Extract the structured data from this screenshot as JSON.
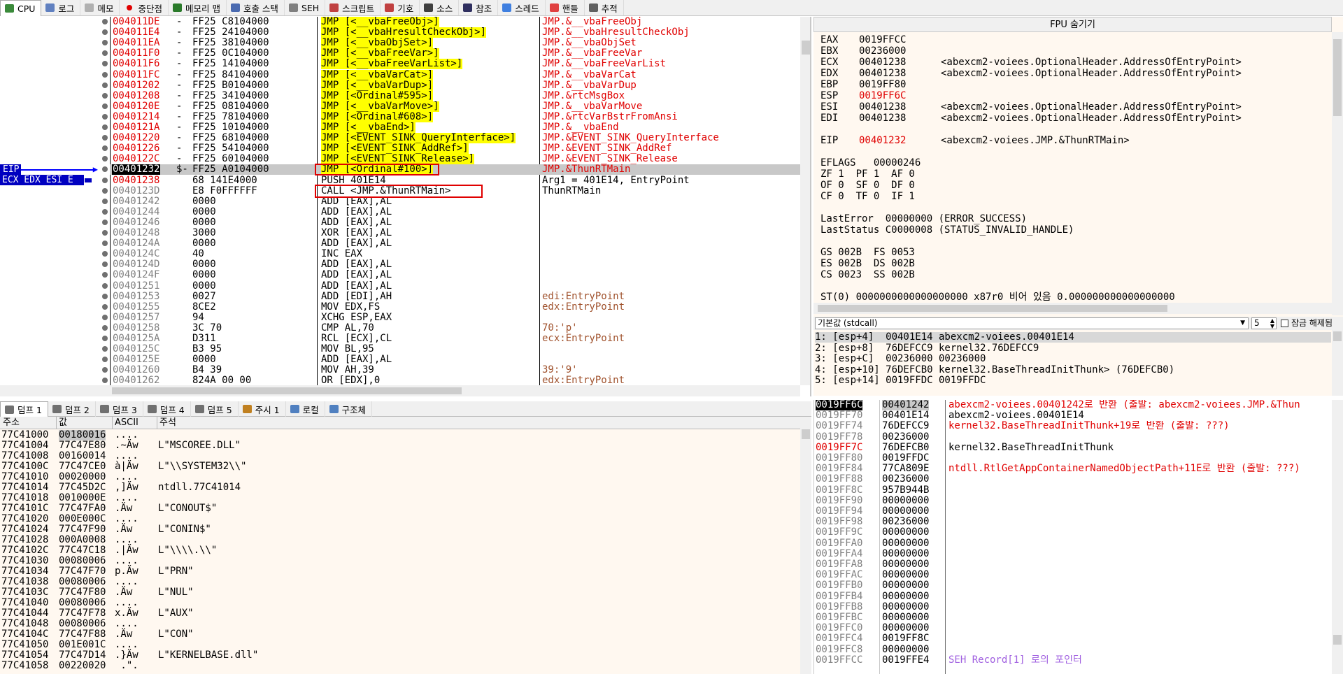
{
  "tabs": [
    {
      "label": "CPU",
      "icon": "cpu-icon",
      "active": true
    },
    {
      "label": "로그",
      "icon": "log-icon"
    },
    {
      "label": "메모",
      "icon": "note-icon"
    },
    {
      "label": "중단점",
      "icon": "breakpoint-icon"
    },
    {
      "label": "메모리 맵",
      "icon": "memory-map-icon"
    },
    {
      "label": "호출 스택",
      "icon": "call-stack-icon"
    },
    {
      "label": "SEH",
      "icon": "seh-icon"
    },
    {
      "label": "스크립트",
      "icon": "script-icon"
    },
    {
      "label": "기호",
      "icon": "symbol-icon"
    },
    {
      "label": "소스",
      "icon": "source-icon"
    },
    {
      "label": "참조",
      "icon": "reference-icon"
    },
    {
      "label": "스레드",
      "icon": "thread-icon"
    },
    {
      "label": "핸들",
      "icon": "handle-icon"
    },
    {
      "label": "추적",
      "icon": "trace-icon"
    }
  ],
  "disasm": {
    "eip_label": "EIP",
    "reg_label": "ECX EDX ESI E",
    "rows": [
      {
        "addr": "004011DE",
        "marker": "-",
        "bytes": "FF25 C8104000",
        "instr": "JMP [<__vbaFreeObj>]",
        "comment": "JMP.&__vbaFreeObj",
        "type": "jmp"
      },
      {
        "addr": "004011E4",
        "marker": "-",
        "bytes": "FF25 24104000",
        "instr": "JMP [<__vbaHresultCheckObj>]",
        "comment": "JMP.&__vbaHresultCheckObj",
        "type": "jmp"
      },
      {
        "addr": "004011EA",
        "marker": "-",
        "bytes": "FF25 38104000",
        "instr": "JMP [<__vbaObjSet>]",
        "comment": "JMP.&__vbaObjSet",
        "type": "jmp"
      },
      {
        "addr": "004011F0",
        "marker": "-",
        "bytes": "FF25 0C104000",
        "instr": "JMP [<__vbaFreeVar>]",
        "comment": "JMP.&__vbaFreeVar",
        "type": "jmp"
      },
      {
        "addr": "004011F6",
        "marker": "-",
        "bytes": "FF25 14104000",
        "instr": "JMP [<__vbaFreeVarList>]",
        "comment": "JMP.&__vbaFreeVarList",
        "type": "jmp"
      },
      {
        "addr": "004011FC",
        "marker": "-",
        "bytes": "FF25 84104000",
        "instr": "JMP [<__vbaVarCat>]",
        "comment": "JMP.&__vbaVarCat",
        "type": "jmp"
      },
      {
        "addr": "00401202",
        "marker": "-",
        "bytes": "FF25 B0104000",
        "instr": "JMP [<__vbaVarDup>]",
        "comment": "JMP.&__vbaVarDup",
        "type": "jmp"
      },
      {
        "addr": "00401208",
        "marker": "-",
        "bytes": "FF25 34104000",
        "instr": "JMP [<Ordinal#595>]",
        "comment": "JMP.&rtcMsgBox",
        "type": "jmp"
      },
      {
        "addr": "0040120E",
        "marker": "-",
        "bytes": "FF25 08104000",
        "instr": "JMP [<__vbaVarMove>]",
        "comment": "JMP.&__vbaVarMove",
        "type": "jmp"
      },
      {
        "addr": "00401214",
        "marker": "-",
        "bytes": "FF25 78104000",
        "instr": "JMP [<Ordinal#608>]",
        "comment": "JMP.&rtcVarBstrFromAnsi",
        "type": "jmp"
      },
      {
        "addr": "0040121A",
        "marker": "-",
        "bytes": "FF25 10104000",
        "instr": "JMP [<__vbaEnd>]",
        "comment": "JMP.&__vbaEnd",
        "type": "jmp"
      },
      {
        "addr": "00401220",
        "marker": "-",
        "bytes": "FF25 68104000",
        "instr": "JMP [<EVENT_SINK_QueryInterface>]",
        "comment": "JMP.&EVENT_SINK_QueryInterface",
        "type": "jmp"
      },
      {
        "addr": "00401226",
        "marker": "-",
        "bytes": "FF25 54104000",
        "instr": "JMP [<EVENT_SINK_AddRef>]",
        "comment": "JMP.&EVENT_SINK_AddRef",
        "type": "jmp"
      },
      {
        "addr": "0040122C",
        "marker": "-",
        "bytes": "FF25 60104000",
        "instr": "JMP [<EVENT_SINK_Release>]",
        "comment": "JMP.&EVENT_SINK_Release",
        "type": "jmp"
      },
      {
        "addr": "00401232",
        "marker": "$-",
        "bytes": "FF25 A0104000",
        "instr": "JMP [<Ordinal#100>]",
        "comment": "JMP.&ThunRTMain",
        "type": "eip"
      },
      {
        "addr": "00401238",
        "marker": "",
        "bytes": "68 141E4000",
        "instr": "PUSH 401E14",
        "comment": "Arg1 = 401E14, EntryPoint",
        "type": "push"
      },
      {
        "addr": "0040123D",
        "marker": "",
        "bytes": "E8 F0FFFFFF",
        "instr": "CALL <JMP.&ThunRTMain>",
        "comment": "ThunRTMain",
        "type": "call"
      },
      {
        "addr": "00401242",
        "marker": "",
        "bytes": "0000",
        "instr": "ADD [EAX],AL",
        "comment": "",
        "type": "norm"
      },
      {
        "addr": "00401244",
        "marker": "",
        "bytes": "0000",
        "instr": "ADD [EAX],AL",
        "comment": "",
        "type": "norm"
      },
      {
        "addr": "00401246",
        "marker": "",
        "bytes": "0000",
        "instr": "ADD [EAX],AL",
        "comment": "",
        "type": "norm"
      },
      {
        "addr": "00401248",
        "marker": "",
        "bytes": "3000",
        "instr": "XOR [EAX],AL",
        "comment": "",
        "type": "norm"
      },
      {
        "addr": "0040124A",
        "marker": "",
        "bytes": "0000",
        "instr": "ADD [EAX],AL",
        "comment": "",
        "type": "norm"
      },
      {
        "addr": "0040124C",
        "marker": "",
        "bytes": "40",
        "instr": "INC EAX",
        "comment": "",
        "type": "norm"
      },
      {
        "addr": "0040124D",
        "marker": "",
        "bytes": "0000",
        "instr": "ADD [EAX],AL",
        "comment": "",
        "type": "norm"
      },
      {
        "addr": "0040124F",
        "marker": "",
        "bytes": "0000",
        "instr": "ADD [EAX],AL",
        "comment": "",
        "type": "norm"
      },
      {
        "addr": "00401251",
        "marker": "",
        "bytes": "0000",
        "instr": "ADD [EAX],AL",
        "comment": "",
        "type": "norm"
      },
      {
        "addr": "00401253",
        "marker": "",
        "bytes": "0027",
        "instr": "ADD [EDI],AH",
        "comment": "edi:EntryPoint",
        "type": "norm"
      },
      {
        "addr": "00401255",
        "marker": "",
        "bytes": "8CE2",
        "instr": "MOV EDX,FS",
        "comment": "edx:EntryPoint",
        "type": "norm"
      },
      {
        "addr": "00401257",
        "marker": "",
        "bytes": "94",
        "instr": "XCHG ESP,EAX",
        "comment": "",
        "type": "norm"
      },
      {
        "addr": "00401258",
        "marker": "",
        "bytes": "3C 70",
        "instr": "CMP AL,70",
        "comment": "70:'p'",
        "type": "norm"
      },
      {
        "addr": "0040125A",
        "marker": "",
        "bytes": "D311",
        "instr": "RCL [ECX],CL",
        "comment": "ecx:EntryPoint",
        "type": "norm"
      },
      {
        "addr": "0040125C",
        "marker": "",
        "bytes": "B3 95",
        "instr": "MOV BL,95",
        "comment": "",
        "type": "norm"
      },
      {
        "addr": "0040125E",
        "marker": "",
        "bytes": "0000",
        "instr": "ADD [EAX],AL",
        "comment": "",
        "type": "norm"
      },
      {
        "addr": "00401260",
        "marker": "",
        "bytes": "B4 39",
        "instr": "MOV AH,39",
        "comment": "39:'9'",
        "type": "norm"
      },
      {
        "addr": "00401262",
        "marker": "",
        "bytes": "824A 00 00",
        "instr": "OR [EDX],0",
        "comment": "edx:EntryPoint",
        "type": "norm"
      }
    ]
  },
  "registers": {
    "title": "FPU 숨기기",
    "lines": [
      {
        "name": "EAX",
        "value": "0019FFCC",
        "comment": "",
        "red": false
      },
      {
        "name": "EBX",
        "value": "00236000",
        "comment": "",
        "red": false
      },
      {
        "name": "ECX",
        "value": "00401238",
        "comment": "<abexcm2-voiees.OptionalHeader.AddressOfEntryPoint>",
        "red": false
      },
      {
        "name": "EDX",
        "value": "00401238",
        "comment": "<abexcm2-voiees.OptionalHeader.AddressOfEntryPoint>",
        "red": false
      },
      {
        "name": "EBP",
        "value": "0019FF80",
        "comment": "",
        "red": false
      },
      {
        "name": "ESP",
        "value": "0019FF6C",
        "comment": "",
        "red": true
      },
      {
        "name": "ESI",
        "value": "00401238",
        "comment": "<abexcm2-voiees.OptionalHeader.AddressOfEntryPoint>",
        "red": false
      },
      {
        "name": "EDI",
        "value": "00401238",
        "comment": "<abexcm2-voiees.OptionalHeader.AddressOfEntryPoint>",
        "red": false
      }
    ],
    "eip": {
      "name": "EIP",
      "value": "00401232",
      "comment": "<abexcm2-voiees.JMP.&ThunRTMain>"
    },
    "eflags": "EFLAGS   00000246",
    "flags": [
      "ZF 1  PF 1  AF 0",
      "OF 0  SF 0  DF 0",
      "CF 0  TF 0  IF 1"
    ],
    "lasterror": "LastError  00000000 (ERROR_SUCCESS)",
    "laststatus": "LastStatus C0000008 (STATUS_INVALID_HANDLE)",
    "segs": [
      "GS 002B  FS 0053",
      "ES 002B  DS 002B",
      "CS 0023  SS 002B"
    ],
    "st0": "ST(0) 0000000000000000000 x87r0 비어 있음 0.000000000000000000"
  },
  "callconv": {
    "select": "기본값 (stdcall)",
    "count": "5",
    "lock_label": "잠금 해제됨",
    "rows": [
      "1: [esp+4]  00401E14 abexcm2-voiees.00401E14",
      "2: [esp+8]  76DEFCC9 kernel32.76DEFCC9",
      "3: [esp+C]  00236000 00236000",
      "4: [esp+10] 76DEFCB0 kernel32.BaseThreadInitThunk> (76DEFCB0)",
      "5: [esp+14] 0019FFDC 0019FFDC"
    ]
  },
  "dump": {
    "tabs": [
      "덤프 1",
      "덤프 2",
      "덤프 3",
      "덤프 4",
      "덤프 5",
      "주시 1",
      "로컬",
      "구조체"
    ],
    "headers": [
      "주소",
      "값",
      "ASCII",
      "주석"
    ],
    "rows": [
      {
        "addr": "77C41000",
        "val": "00180016",
        "ascii": "....",
        "cmt": ""
      },
      {
        "addr": "77C41004",
        "val": "77C47E80",
        "ascii": ".~Äw",
        "cmt": "L\"MSCOREE.DLL\""
      },
      {
        "addr": "77C41008",
        "val": "00160014",
        "ascii": "....",
        "cmt": ""
      },
      {
        "addr": "77C4100C",
        "val": "77C47CE0",
        "ascii": "à|Äw",
        "cmt": "L\"\\\\SYSTEM32\\\\\""
      },
      {
        "addr": "77C41010",
        "val": "00020000",
        "ascii": "....",
        "cmt": ""
      },
      {
        "addr": "77C41014",
        "val": "77C45D2C",
        "ascii": ",]Äw",
        "cmt": "ntdll.77C41014"
      },
      {
        "addr": "77C41018",
        "val": "0010000E",
        "ascii": "....",
        "cmt": ""
      },
      {
        "addr": "77C4101C",
        "val": "77C47FA0",
        "ascii": ".Äw",
        "cmt": "L\"CONOUT$\""
      },
      {
        "addr": "77C41020",
        "val": "000E000C",
        "ascii": "....",
        "cmt": ""
      },
      {
        "addr": "77C41024",
        "val": "77C47F90",
        "ascii": ".Äw",
        "cmt": "L\"CONIN$\""
      },
      {
        "addr": "77C41028",
        "val": "000A0008",
        "ascii": "....",
        "cmt": ""
      },
      {
        "addr": "77C4102C",
        "val": "77C47C18",
        "ascii": ".|Äw",
        "cmt": "L\"\\\\\\\\.\\\\\""
      },
      {
        "addr": "77C41030",
        "val": "00080006",
        "ascii": "....",
        "cmt": ""
      },
      {
        "addr": "77C41034",
        "val": "77C47F70",
        "ascii": "p.Äw",
        "cmt": "L\"PRN\""
      },
      {
        "addr": "77C41038",
        "val": "00080006",
        "ascii": "....",
        "cmt": ""
      },
      {
        "addr": "77C4103C",
        "val": "77C47F80",
        "ascii": ".Äw",
        "cmt": "L\"NUL\""
      },
      {
        "addr": "77C41040",
        "val": "00080006",
        "ascii": "....",
        "cmt": ""
      },
      {
        "addr": "77C41044",
        "val": "77C47F78",
        "ascii": "x.Äw",
        "cmt": "L\"AUX\""
      },
      {
        "addr": "77C41048",
        "val": "00080006",
        "ascii": "....",
        "cmt": ""
      },
      {
        "addr": "77C4104C",
        "val": "77C47F88",
        "ascii": ".Äw",
        "cmt": "L\"CON\""
      },
      {
        "addr": "77C41050",
        "val": "001E001C",
        "ascii": "....",
        "cmt": ""
      },
      {
        "addr": "77C41054",
        "val": "77C47D14",
        "ascii": ".}Äw",
        "cmt": "L\"KERNELBASE.dll\""
      },
      {
        "addr": "77C41058",
        "val": "00220020",
        "ascii": " .\".",
        "cmt": ""
      }
    ]
  },
  "stack": {
    "rows": [
      {
        "addr": "0019FF6C",
        "val": "00401242",
        "cmt": "abexcm2-voiees.00401242로 반환 (출발: abexcm2-voiees.JMP.&Thun",
        "sel": true,
        "red_cmt": true
      },
      {
        "addr": "0019FF70",
        "val": "00401E14",
        "cmt": "abexcm2-voiees.00401E14"
      },
      {
        "addr": "0019FF74",
        "val": "76DEFCC9",
        "cmt": "kernel32.BaseThreadInitThunk+19로 반환 (출발: ???)",
        "red_cmt": true
      },
      {
        "addr": "0019FF78",
        "val": "00236000",
        "cmt": ""
      },
      {
        "addr": "0019FF7C",
        "val": "76DEFCB0",
        "cmt": "kernel32.BaseThreadInitThunk",
        "red_addr": true
      },
      {
        "addr": "0019FF80",
        "val": "0019FFDC",
        "cmt": ""
      },
      {
        "addr": "0019FF84",
        "val": "77CA809E",
        "cmt": "ntdll.RtlGetAppContainerNamedObjectPath+11E로 반환 (출발: ???)",
        "red_cmt": true
      },
      {
        "addr": "0019FF88",
        "val": "00236000",
        "cmt": ""
      },
      {
        "addr": "0019FF8C",
        "val": "957B944B",
        "cmt": ""
      },
      {
        "addr": "0019FF90",
        "val": "00000000",
        "cmt": ""
      },
      {
        "addr": "0019FF94",
        "val": "00000000",
        "cmt": ""
      },
      {
        "addr": "0019FF98",
        "val": "00236000",
        "cmt": ""
      },
      {
        "addr": "0019FF9C",
        "val": "00000000",
        "cmt": ""
      },
      {
        "addr": "0019FFA0",
        "val": "00000000",
        "cmt": ""
      },
      {
        "addr": "0019FFA4",
        "val": "00000000",
        "cmt": ""
      },
      {
        "addr": "0019FFA8",
        "val": "00000000",
        "cmt": ""
      },
      {
        "addr": "0019FFAC",
        "val": "00000000",
        "cmt": ""
      },
      {
        "addr": "0019FFB0",
        "val": "00000000",
        "cmt": ""
      },
      {
        "addr": "0019FFB4",
        "val": "00000000",
        "cmt": ""
      },
      {
        "addr": "0019FFB8",
        "val": "00000000",
        "cmt": ""
      },
      {
        "addr": "0019FFBC",
        "val": "00000000",
        "cmt": ""
      },
      {
        "addr": "0019FFC0",
        "val": "00000000",
        "cmt": ""
      },
      {
        "addr": "0019FFC4",
        "val": "0019FF8C",
        "cmt": ""
      },
      {
        "addr": "0019FFC8",
        "val": "00000000",
        "cmt": ""
      },
      {
        "addr": "0019FFCC",
        "val": "0019FFE4",
        "cmt": "SEH Record[1] 로의 포인터",
        "purple": true
      }
    ]
  },
  "colors": {
    "accent": "#0000ff",
    "eip_bg": "#0000c0",
    "highlight": "#ffff00",
    "red": "#e00000"
  }
}
